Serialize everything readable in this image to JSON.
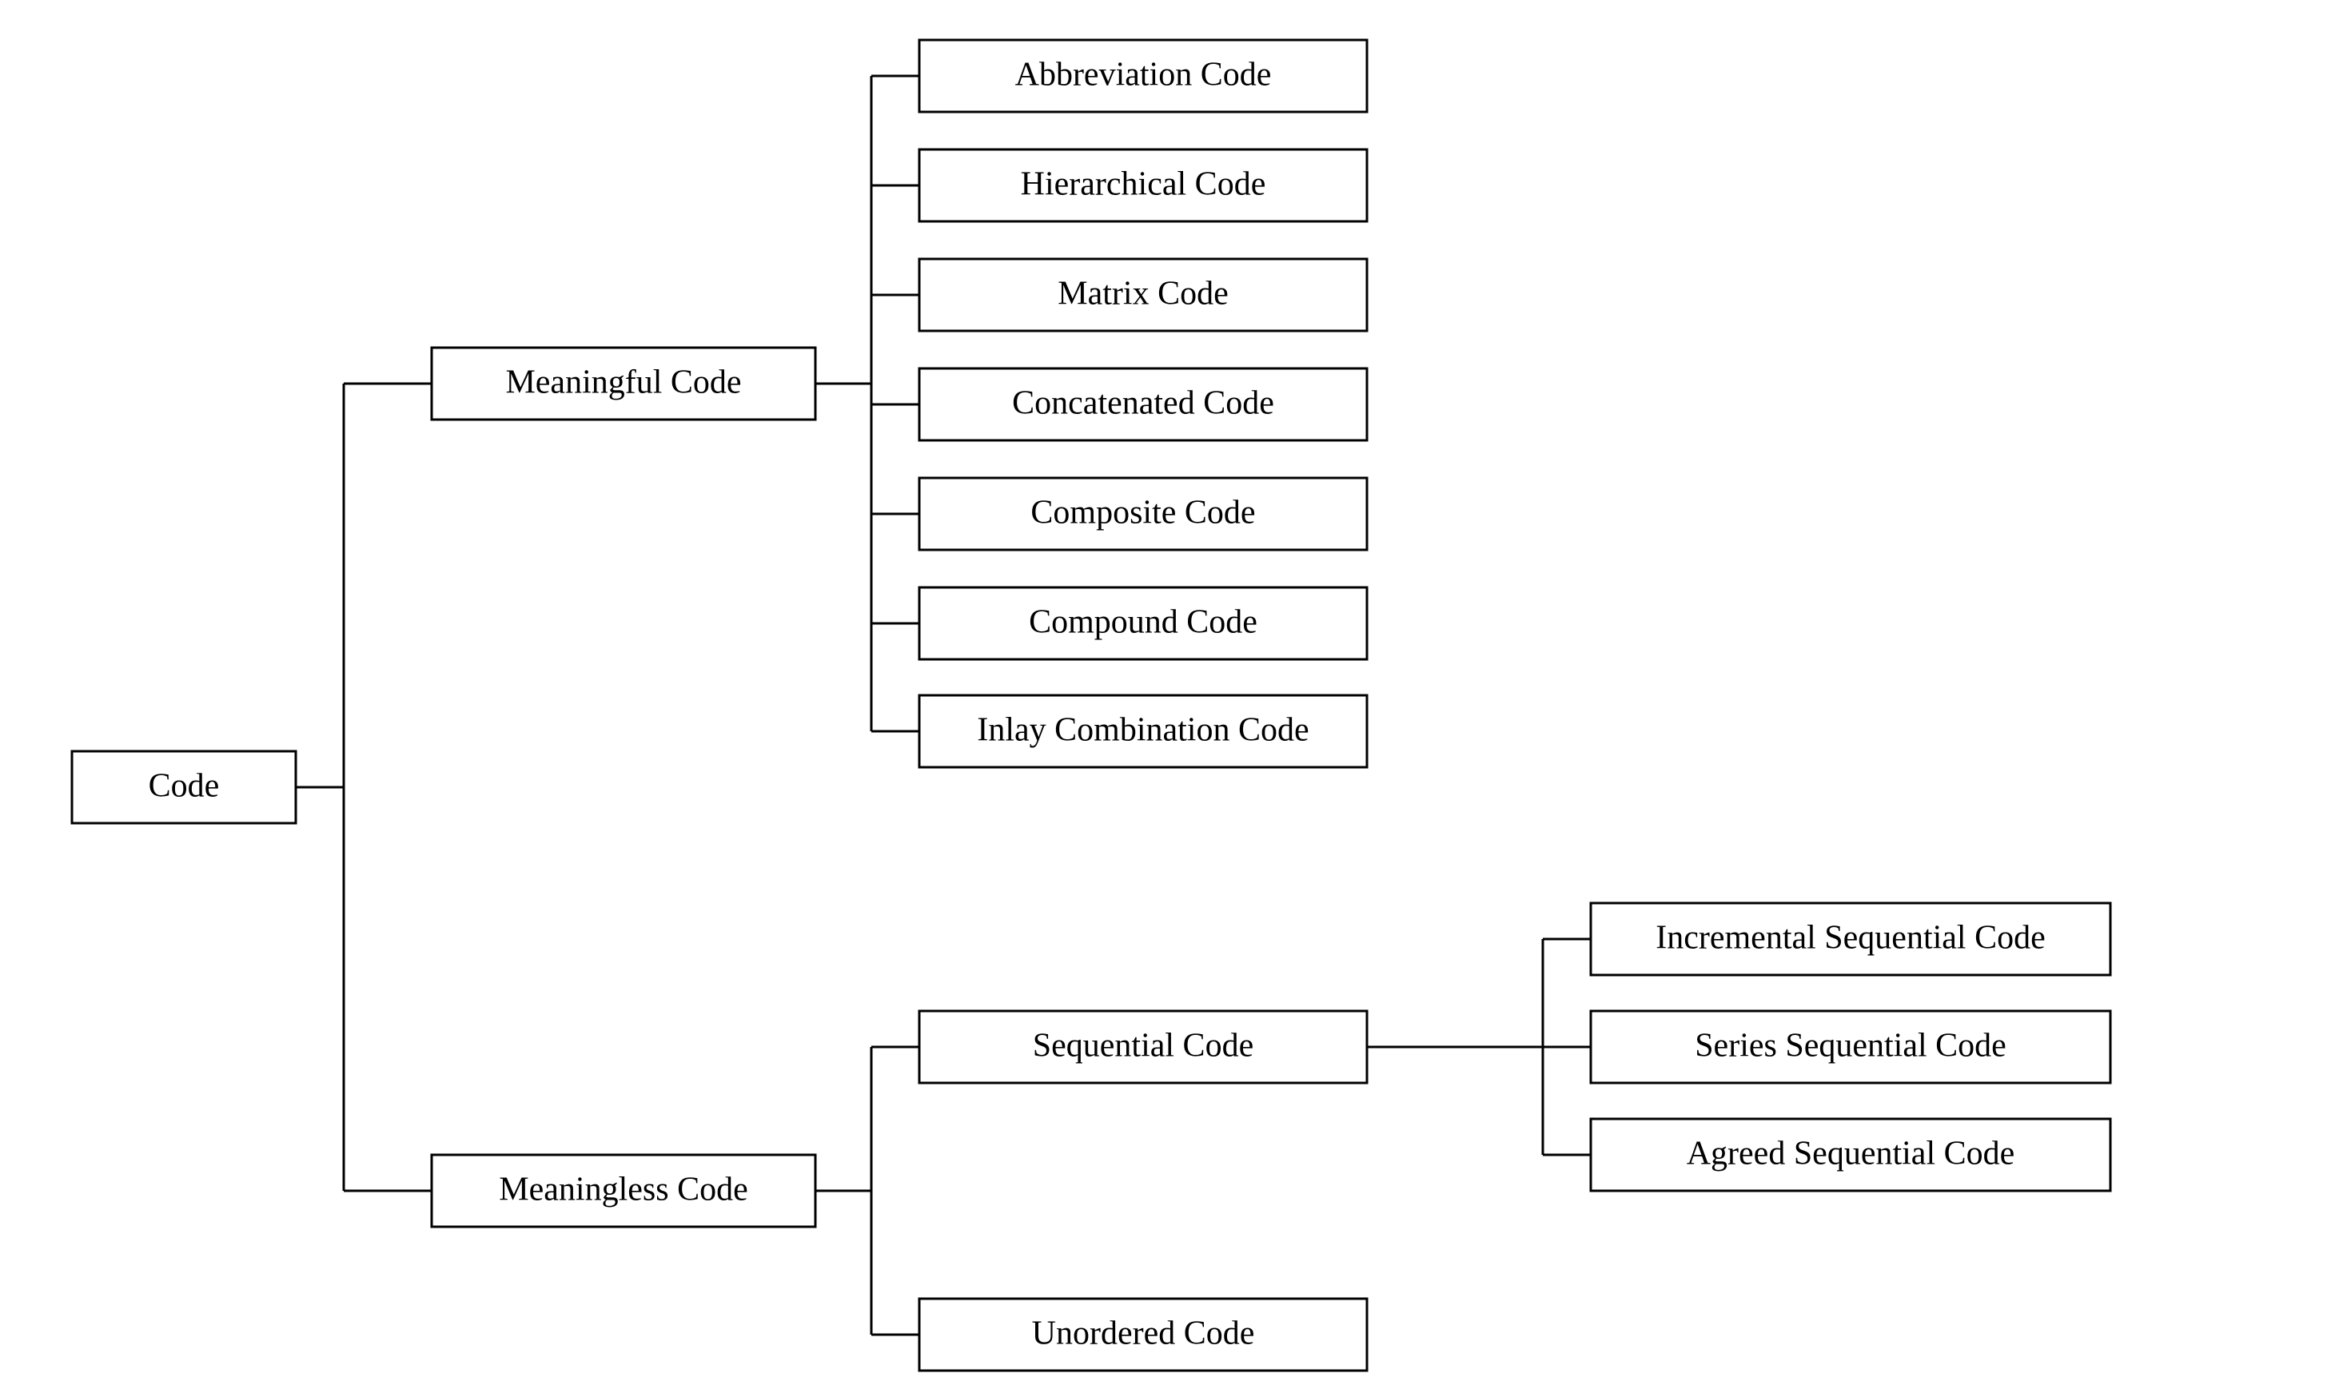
{
  "root": {
    "label": "Code"
  },
  "level1": [
    {
      "label": "Meaningful Code"
    },
    {
      "label": "Meaningless Code"
    }
  ],
  "meaningful_children": [
    {
      "label": "Abbreviation Code"
    },
    {
      "label": "Hierarchical Code"
    },
    {
      "label": "Matrix Code"
    },
    {
      "label": "Concatenated Code"
    },
    {
      "label": "Composite Code"
    },
    {
      "label": "Compound Code"
    },
    {
      "label": "Inlay Combination Code"
    }
  ],
  "meaningless_children": [
    {
      "label": "Sequential Code"
    },
    {
      "label": "Unordered Code"
    }
  ],
  "sequential_children": [
    {
      "label": "Incremental Sequential Code"
    },
    {
      "label": "Series Sequential  Code"
    },
    {
      "label": "Agreed Sequential Code"
    }
  ]
}
